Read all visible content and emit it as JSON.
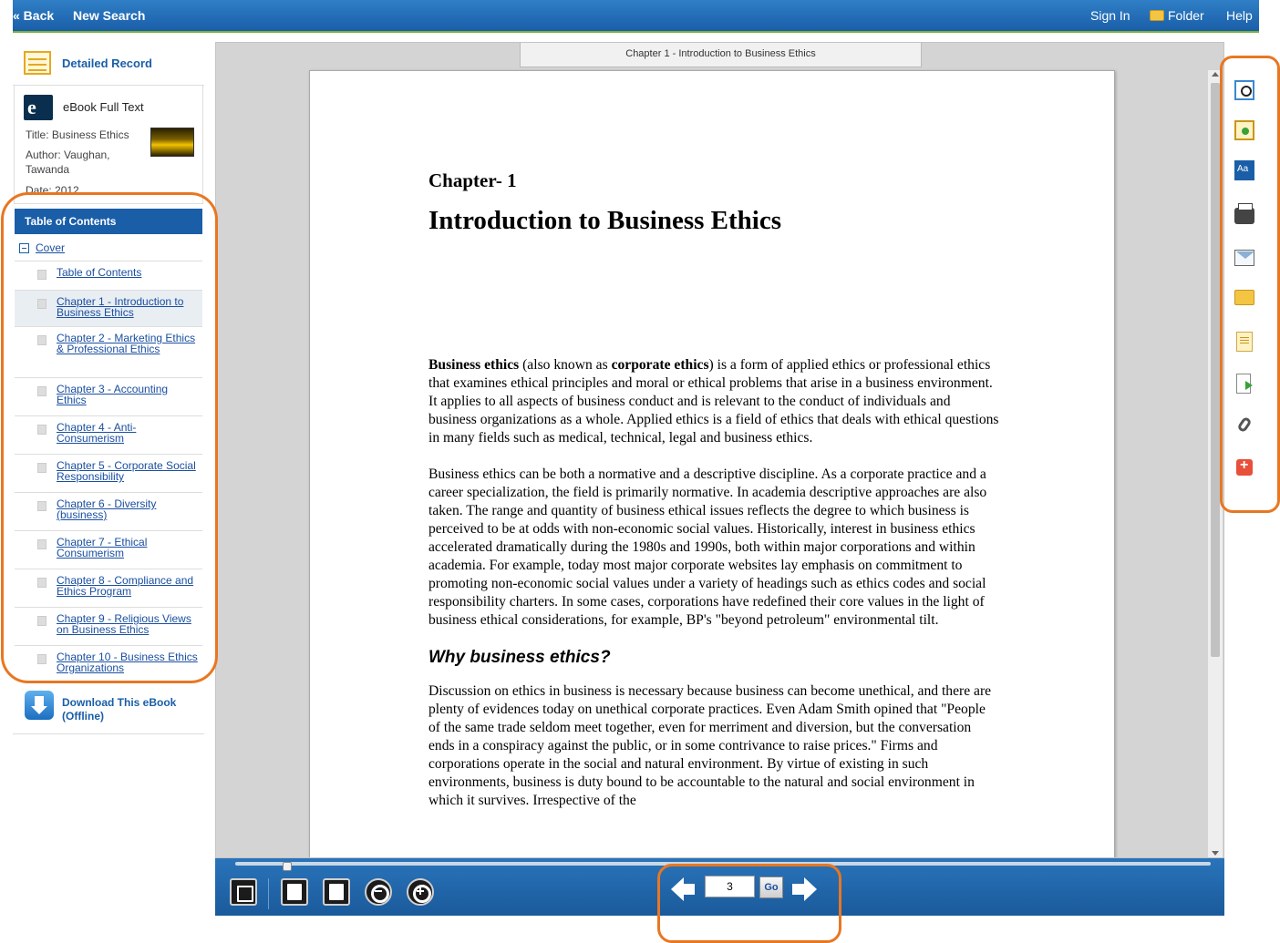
{
  "topbar": {
    "back": "« Back",
    "new_search": "New Search",
    "sign_in": "Sign In",
    "folder": "Folder",
    "help": "Help"
  },
  "sidebar": {
    "detailed_record": "Detailed Record",
    "ebook_full_text": "eBook Full Text",
    "title_line": "Title: Business Ethics",
    "author_line": "Author: Vaughan, Tawanda",
    "date_line": "Date: 2012",
    "download": "Download This eBook (Offline)"
  },
  "toc": {
    "header": "Table of Contents",
    "cover": "Cover",
    "items": [
      {
        "label": "Table of Contents"
      },
      {
        "label": "Chapter 1 - Introduction to Business Ethics",
        "selected": true
      },
      {
        "label": "Chapter 2 - Marketing Ethics & Professional Ethics"
      },
      {
        "label": "Chapter 3 - Accounting Ethics"
      },
      {
        "label": "Chapter 4 - Anti-Consumerism"
      },
      {
        "label": "Chapter 5 - Corporate Social Responsibility"
      },
      {
        "label": "Chapter 6 - Diversity (business)"
      },
      {
        "label": "Chapter 7 - Ethical Consumerism"
      },
      {
        "label": "Chapter 8 - Compliance and Ethics Program"
      },
      {
        "label": "Chapter 9 - Religious Views on Business Ethics"
      },
      {
        "label": "Chapter 10 - Business Ethics Organizations"
      }
    ]
  },
  "viewer": {
    "chapter_tab": "Chapter 1 - Introduction to Business Ethics",
    "chapter_num": "Chapter- 1",
    "chapter_title": "Introduction to Business Ethics",
    "para1_b1": "Business ethics",
    "para1_t1": " (also known as ",
    "para1_b2": "corporate ethics",
    "para1_t2": ") is a form of applied ethics or professional ethics that examines ethical principles and moral or ethical problems that arise in a business environment. It applies to all aspects of business conduct and is relevant to the conduct of individuals and business organizations as a whole. Applied ethics is a field of ethics that deals with ethical questions in many fields such as medical, technical, legal and business ethics.",
    "para2": "Business ethics can be both a normative and a descriptive discipline. As a corporate practice and a career specialization, the field is primarily normative. In academia descriptive approaches are also taken. The range and quantity of business ethical issues reflects the degree to which business is perceived to be at odds with non-economic social values. Historically, interest in business ethics accelerated dramatically during the 1980s and 1990s, both within major corporations and within academia. For example, today most major corporate websites lay emphasis on commitment to promoting non-economic social values under a variety of headings such as ethics codes and social responsibility charters. In some cases, corporations have redefined their core values in the light of business ethical considerations, for example, BP's \"beyond petroleum\" environmental tilt.",
    "section_heading": "Why business ethics?",
    "para3": "Discussion on ethics in business is necessary because business can become unethical, and there are plenty of evidences today on unethical corporate practices. Even Adam Smith opined that \"People of the same trade seldom meet together, even for merriment and diversion, but the conversation ends in a conspiracy against the public, or in some contrivance to raise prices.\" Firms and corporations operate in the social and natural environment. By virtue of existing in such environments, business is duty bound to be accountable to the natural and social environment in which it survives. Irrespective of the"
  },
  "pager": {
    "page_value": "3",
    "go": "Go"
  },
  "colors": {
    "brand_blue": "#1a5ea8",
    "highlight_orange": "#e87722"
  },
  "icons": {
    "tools": [
      "search-within-icon",
      "add-to-folder-icon",
      "cite-icon",
      "print-icon",
      "email-icon",
      "save-icon",
      "notes-icon",
      "export-icon",
      "permalink-icon",
      "share-icon"
    ]
  }
}
